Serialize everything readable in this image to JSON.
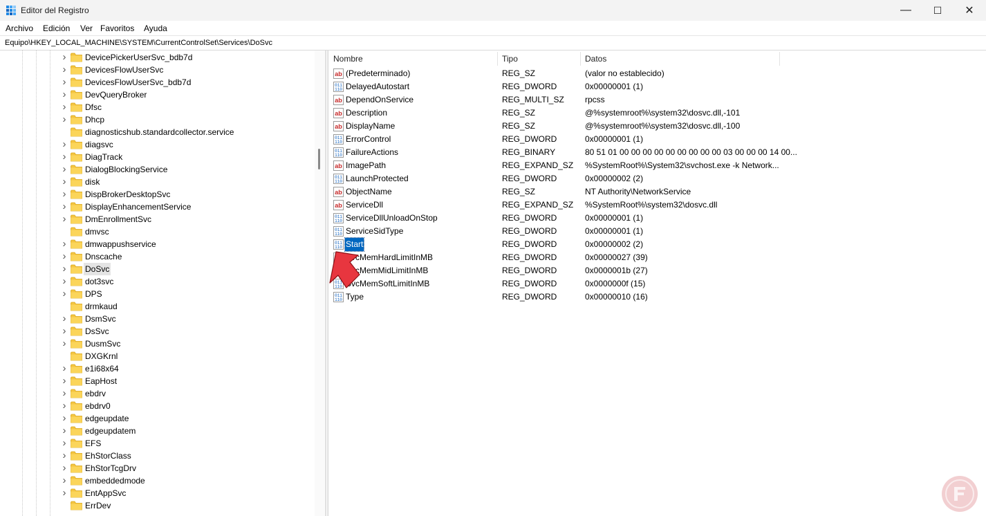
{
  "window": {
    "title": "Editor del Registro",
    "minimize": "—",
    "maximize": "☐",
    "close": "✕"
  },
  "menu": [
    "Archivo",
    "Edición",
    "Ver",
    "Favoritos",
    "Ayuda"
  ],
  "address": "Equipo\\HKEY_LOCAL_MACHINE\\SYSTEM\\CurrentControlSet\\Services\\DoSvc",
  "tree": {
    "items": [
      {
        "label": "DevicePickerUserSvc_bdb7d",
        "expandable": true
      },
      {
        "label": "DevicesFlowUserSvc",
        "expandable": true
      },
      {
        "label": "DevicesFlowUserSvc_bdb7d",
        "expandable": true
      },
      {
        "label": "DevQueryBroker",
        "expandable": true
      },
      {
        "label": "Dfsc",
        "expandable": true
      },
      {
        "label": "Dhcp",
        "expandable": true
      },
      {
        "label": "diagnosticshub.standardcollector.service",
        "expandable": false
      },
      {
        "label": "diagsvc",
        "expandable": true
      },
      {
        "label": "DiagTrack",
        "expandable": true
      },
      {
        "label": "DialogBlockingService",
        "expandable": true
      },
      {
        "label": "disk",
        "expandable": true
      },
      {
        "label": "DispBrokerDesktopSvc",
        "expandable": true
      },
      {
        "label": "DisplayEnhancementService",
        "expandable": true
      },
      {
        "label": "DmEnrollmentSvc",
        "expandable": true
      },
      {
        "label": "dmvsc",
        "expandable": false
      },
      {
        "label": "dmwappushservice",
        "expandable": true
      },
      {
        "label": "Dnscache",
        "expandable": true
      },
      {
        "label": "DoSvc",
        "expandable": true,
        "selected": true
      },
      {
        "label": "dot3svc",
        "expandable": true
      },
      {
        "label": "DPS",
        "expandable": true
      },
      {
        "label": "drmkaud",
        "expandable": false
      },
      {
        "label": "DsmSvc",
        "expandable": true
      },
      {
        "label": "DsSvc",
        "expandable": true
      },
      {
        "label": "DusmSvc",
        "expandable": true
      },
      {
        "label": "DXGKrnl",
        "expandable": false
      },
      {
        "label": "e1i68x64",
        "expandable": true
      },
      {
        "label": "EapHost",
        "expandable": true
      },
      {
        "label": "ebdrv",
        "expandable": true
      },
      {
        "label": "ebdrv0",
        "expandable": true
      },
      {
        "label": "edgeupdate",
        "expandable": true
      },
      {
        "label": "edgeupdatem",
        "expandable": true
      },
      {
        "label": "EFS",
        "expandable": true
      },
      {
        "label": "EhStorClass",
        "expandable": true
      },
      {
        "label": "EhStorTcgDrv",
        "expandable": true
      },
      {
        "label": "embeddedmode",
        "expandable": true
      },
      {
        "label": "EntAppSvc",
        "expandable": true
      },
      {
        "label": "ErrDev",
        "expandable": false
      }
    ]
  },
  "columns": {
    "name": "Nombre",
    "type": "Tipo",
    "data": "Datos"
  },
  "values": [
    {
      "name": "(Predeterminado)",
      "type": "REG_SZ",
      "data": "(valor no establecido)",
      "icon": "string-value-icon"
    },
    {
      "name": "DelayedAutostart",
      "type": "REG_DWORD",
      "data": "0x00000001 (1)",
      "icon": "binary-value-icon"
    },
    {
      "name": "DependOnService",
      "type": "REG_MULTI_SZ",
      "data": "rpcss",
      "icon": "string-value-icon"
    },
    {
      "name": "Description",
      "type": "REG_SZ",
      "data": "@%systemroot%\\system32\\dosvc.dll,-101",
      "icon": "string-value-icon"
    },
    {
      "name": "DisplayName",
      "type": "REG_SZ",
      "data": "@%systemroot%\\system32\\dosvc.dll,-100",
      "icon": "string-value-icon"
    },
    {
      "name": "ErrorControl",
      "type": "REG_DWORD",
      "data": "0x00000001 (1)",
      "icon": "binary-value-icon"
    },
    {
      "name": "FailureActions",
      "type": "REG_BINARY",
      "data": "80 51 01 00 00 00 00 00 00 00 00 00 03 00 00 00 14 00...",
      "icon": "binary-value-icon"
    },
    {
      "name": "ImagePath",
      "type": "REG_EXPAND_SZ",
      "data": "%SystemRoot%\\System32\\svchost.exe -k Network...",
      "icon": "string-value-icon"
    },
    {
      "name": "LaunchProtected",
      "type": "REG_DWORD",
      "data": "0x00000002 (2)",
      "icon": "binary-value-icon"
    },
    {
      "name": "ObjectName",
      "type": "REG_SZ",
      "data": "NT Authority\\NetworkService",
      "icon": "string-value-icon"
    },
    {
      "name": "ServiceDll",
      "type": "REG_EXPAND_SZ",
      "data": "%SystemRoot%\\system32\\dosvc.dll",
      "icon": "string-value-icon"
    },
    {
      "name": "ServiceDllUnloadOnStop",
      "type": "REG_DWORD",
      "data": "0x00000001 (1)",
      "icon": "binary-value-icon"
    },
    {
      "name": "ServiceSidType",
      "type": "REG_DWORD",
      "data": "0x00000001 (1)",
      "icon": "binary-value-icon"
    },
    {
      "name": "Start",
      "type": "REG_DWORD",
      "data": "0x00000002 (2)",
      "icon": "binary-value-icon",
      "selected": true
    },
    {
      "name": "SvcMemHardLimitInMB",
      "type": "REG_DWORD",
      "data": "0x00000027 (39)",
      "icon": "binary-value-icon"
    },
    {
      "name": "SvcMemMidLimitInMB",
      "type": "REG_DWORD",
      "data": "0x0000001b (27)",
      "icon": "binary-value-icon"
    },
    {
      "name": "SvcMemSoftLimitInMB",
      "type": "REG_DWORD",
      "data": "0x0000000f (15)",
      "icon": "binary-value-icon"
    },
    {
      "name": "Type",
      "type": "REG_DWORD",
      "data": "0x00000010 (16)",
      "icon": "binary-value-icon"
    }
  ],
  "colors": {
    "selection": "#0067c0",
    "folder": "#f4c542",
    "arrow": "#e8363f",
    "watermark": "#c2262e"
  }
}
